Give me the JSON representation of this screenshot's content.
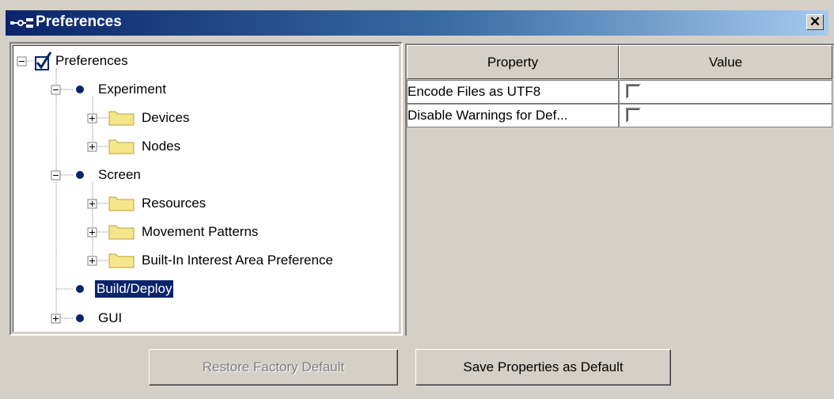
{
  "window": {
    "title": "Preferences",
    "close_glyph": "✕"
  },
  "tree": {
    "root": "Preferences",
    "items": [
      "Experiment",
      "Devices",
      "Nodes",
      "Screen",
      "Resources",
      "Movement Patterns",
      "Built-In Interest Area Preference",
      "Build/Deploy",
      "GUI"
    ],
    "selected": "Build/Deploy"
  },
  "properties": {
    "headers": {
      "property": "Property",
      "value": "Value"
    },
    "rows": [
      {
        "name": "Encode Files as UTF8",
        "checked": false
      },
      {
        "name": "Disable Warnings for Def...",
        "checked": false
      }
    ]
  },
  "buttons": {
    "restore": "Restore Factory Default",
    "save": "Save Properties as Default"
  },
  "colors": {
    "selection": "#0a246a",
    "titlebar_start": "#0a246a",
    "titlebar_end": "#a6caf0"
  }
}
